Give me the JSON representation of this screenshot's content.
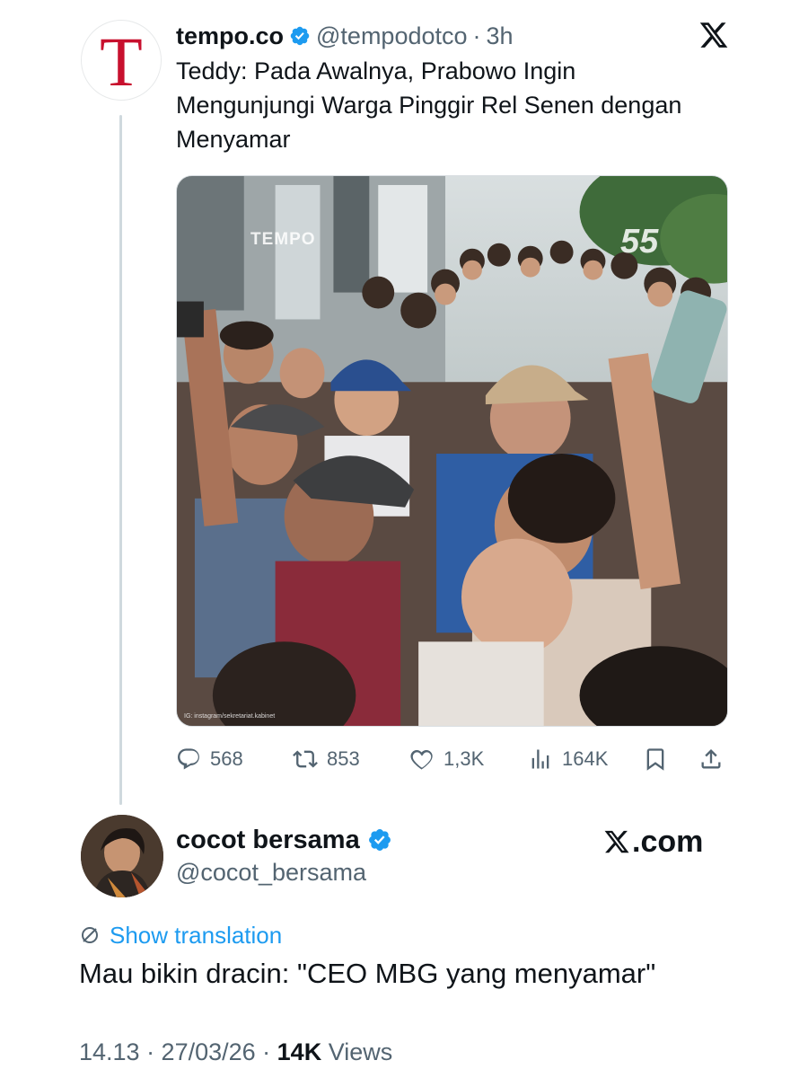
{
  "quoted_tweet": {
    "avatar_letter": "T",
    "display_name": "tempo.co",
    "handle": "@tempodotco",
    "separator": "·",
    "time": "3h",
    "text": "Teddy: Pada Awalnya, Prabowo Ingin Mengunjungi Warga Pinggir Rel Senen dengan Menyamar",
    "photo": {
      "watermark_left": "TEMPO",
      "watermark_right": "55",
      "credit": "IG: instagram/sekretariat.kabinet"
    },
    "stats": {
      "replies": "568",
      "reposts": "853",
      "likes": "1,3K",
      "views": "164K"
    },
    "icons": [
      "x-logo-icon",
      "verified-badge-icon",
      "reply-icon",
      "repost-icon",
      "like-icon",
      "views-icon",
      "bookmark-icon",
      "share-icon"
    ]
  },
  "main_tweet": {
    "display_name": "cocot bersama",
    "handle": "@cocot_bersama",
    "brand_suffix": ".com",
    "show_translation": "Show translation",
    "text": "Mau bikin dracin: \"CEO MBG yang menyamar\"",
    "timestamp": "14.13 · 27/03/26 · ",
    "views_count": "14K",
    "views_label": " Views"
  },
  "colors": {
    "accent": "#1d9bf0",
    "text_primary": "#0f1419",
    "text_secondary": "#536471",
    "tempo_red": "#c8102e",
    "thread_line": "#cfd9de"
  }
}
